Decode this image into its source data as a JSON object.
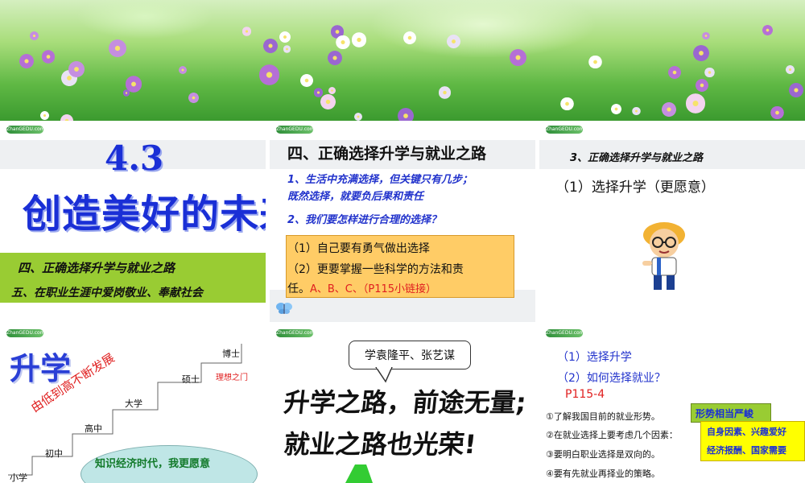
{
  "logo_text": "ZhanGEDU.com",
  "slide1": {
    "number": "4.3",
    "title": "创造美好的未来",
    "line1": "四、正确选择升学与就业之路",
    "line2": "五、在职业生涯中爱岗敬业、奉献社会"
  },
  "slide2": {
    "heading": "四、正确选择升学与就业之路",
    "point1_a": "1、生活中充满选择，但关键只有几步；",
    "point1_b": "既然选择，就要负后果和责任",
    "point2": "2、我们要怎样进行合理的选择？",
    "box_line1": "（1）自己要有勇气做出选择",
    "box_line2": "（2）更要掌握一些科学的方法和责",
    "box_line3_black": "任。",
    "box_line3_red": "A、B、C、（P115小链接）"
  },
  "slide3": {
    "heading": "3、正确选择升学与就业之路",
    "subheading": "（1）选择升学（更愿意）"
  },
  "slide4": {
    "title": "升学",
    "diagonal": "由低到高不断发展",
    "steps": [
      "小学",
      "初中",
      "高中",
      "大学",
      "硕士",
      "博士"
    ],
    "ideal_gate": "理想之门",
    "ellipse_text": "知识经济时代，我更愿意"
  },
  "slide5": {
    "callout": "学袁隆平、张艺谋",
    "big_line1": "升学之路，前途无量;",
    "big_line2": "就业之路也光荣!"
  },
  "slide6": {
    "item1": "（1）选择升学",
    "item2": "（2）如何选择就业？",
    "ref": "P115-4",
    "list": [
      "①了解我国目前的就业形势。",
      "②在就业选择上要考虑几个因素：",
      "③要明白职业选择是双向的。",
      "④要有先就业再择业的策略。"
    ],
    "badge1": "形势相当严峻",
    "badge2_line1": "自身因素、兴趣爱好",
    "badge2_line2": "经济报酬、国家需要"
  },
  "colors": {
    "blue_title": "#1a2fd6",
    "green_bar": "#99cc33",
    "orange_box": "#ffcc66",
    "red_text": "#e02020"
  }
}
